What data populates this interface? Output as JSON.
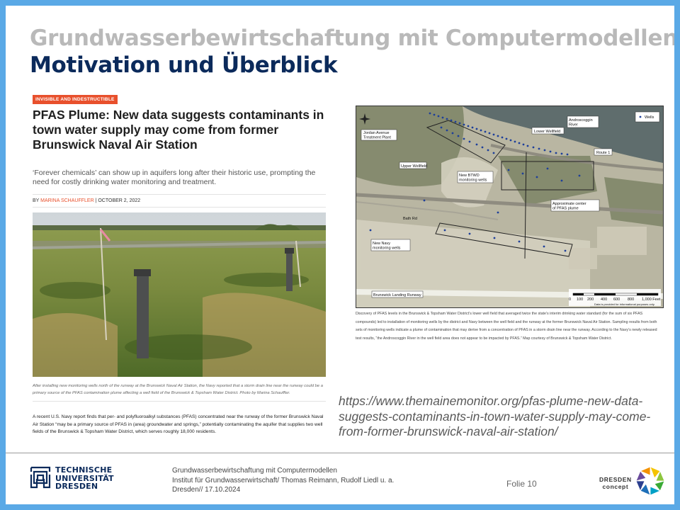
{
  "slide": {
    "title": "Grundwasserbewirtschaftung mit Computermodellen",
    "subtitle": "Motivation und Überblick",
    "url": "https://www.themainemonitor.org/pfas-plume-new-data-suggests-contaminants-in-town-water-supply-may-come-from-former-brunswick-naval-air-station/"
  },
  "article": {
    "tag": "INVISIBLE AND INDESTRUCTIBLE",
    "headline": "PFAS Plume: New data suggests contaminants in town water supply may come from former Brunswick Naval Air Station",
    "subhead": "‘Forever chemicals’ can show up in aquifers long after their historic use, prompting the need for costly drinking water monitoring and treatment.",
    "byline_prefix": "BY",
    "author": "MARINA SCHAUFFLER",
    "date": "| OCTOBER 2, 2022",
    "photo_caption": "After installing new monitoring wells north of the runway at the Brunswick Naval Air Station, the Navy reported that a storm drain line near the runway could be a primary source of the PFAS contamination plume affecting a well field of the Brunswick & Topsham Water District. Photo by Marina Schauffler.",
    "body": "A recent U.S. Navy report finds that per- and polyfluoroalkyl substances (PFAS) concentrated near the runway of the former Brunswick Naval Air Station “may be a primary source of PFAS in (area) groundwater and springs,” potentially contaminating the aquifer that supplies two well fields of the Brunswick & Topsham Water District, which serves roughly 18,000 residents."
  },
  "map": {
    "labels": {
      "jordan": "Jordan Avenue Treatment Plant",
      "lower": "Lower Wellfield",
      "androscoggin": "Androscoggin River",
      "wells_legend": "Wells",
      "upper": "Upper Wellfield",
      "route1": "Route 1",
      "btwd": "New BTWD monitoring wells",
      "plume": "Approximate center of PFAS plume",
      "bath": "Bath Rd",
      "navy": "New Navy monitoring wells",
      "runway": "Brunswick Landing Runway",
      "disclaimer": "Data is provided for informational purposes only."
    },
    "scale": [
      "0",
      "100",
      "200",
      "400",
      "600",
      "800",
      "1,000 Feet"
    ],
    "caption": "Discovery of PFAS levels in the Brunswick & Topsham Water District’s lower well field that averaged twice the state’s interim drinking water standard (for the sum of six PFAS compounds) led to installation of monitoring wells by the district and Navy between the well field and the runway at the former Brunswick Naval Air Station. Sampling results from both sets of monitoring wells indicate a plume of contamination that may derive from a concentration of PFAS in a storm drain line near the runway. According to the Navy’s newly released test results, “the Androscoggin River in the well field area does not appear to be impacted by PFAS.” Map courtesy of Brunswick & Topsham Water District."
  },
  "footer": {
    "tud_line1": "TECHNISCHE",
    "tud_line2": "UNIVERSITÄT",
    "tud_line3": "DRESDEN",
    "info_line1": "Grundwasserbewirtschaftung mit Computermodellen",
    "info_line2": "Institut für Grundwasserwirtschaft/ Thomas Reimann, Rudolf Liedl u. a.",
    "info_line3": "Dresden// 17.10.2024",
    "folie": "Folie 10",
    "dc_line1": "DRESDEN",
    "dc_line2": "concept"
  },
  "colors": {
    "title_gray": "#b9b9b9",
    "title_blue": "#0b2a5b",
    "tag_orange": "#e8502c",
    "frame_blue": "#5aa9e6"
  }
}
